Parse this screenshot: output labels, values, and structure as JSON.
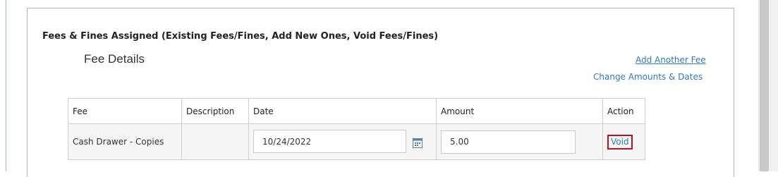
{
  "section": {
    "title": "Fees & Fines Assigned (Existing Fees/Fines, Add New Ones, Void Fees/Fines)",
    "subtitle": "Fee Details"
  },
  "links": {
    "add_fee": "Add Another Fee",
    "change_amounts": "Change Amounts & Dates"
  },
  "table": {
    "headers": {
      "fee": "Fee",
      "description": "Description",
      "date": "Date",
      "amount": "Amount",
      "action": "Action"
    },
    "rows": [
      {
        "fee": "Cash Drawer - Copies",
        "description": "",
        "date": "10/24/2022",
        "amount": "5.00",
        "action": "Void"
      }
    ]
  },
  "icons": {
    "date_picker": "calendar-icon"
  },
  "colors": {
    "link": "#2a7bbf",
    "highlight_border": "#b8141e"
  }
}
